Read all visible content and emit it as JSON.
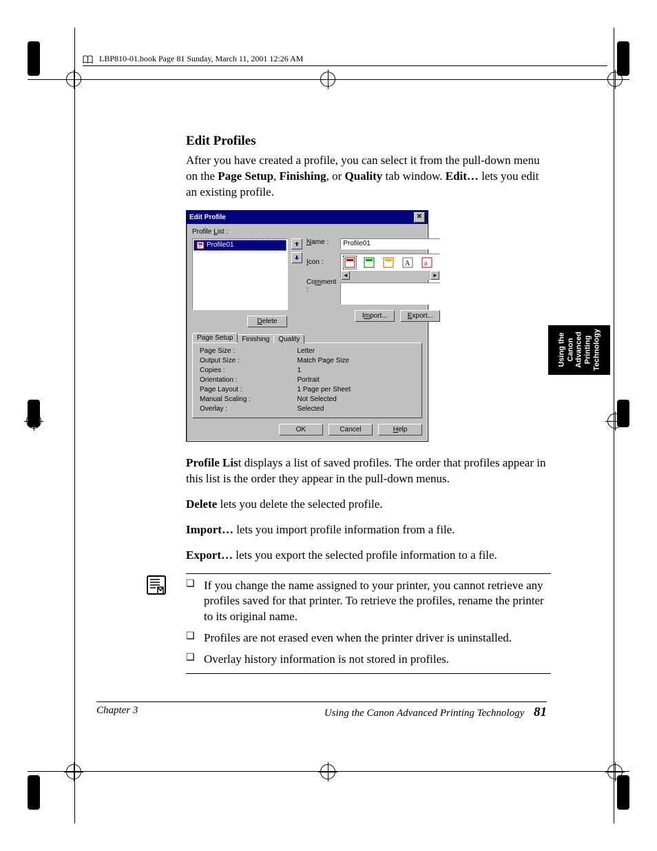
{
  "header": "LBP810-01.book  Page 81  Sunday, March 11, 2001  12:26 AM",
  "section_title": "Edit Profiles",
  "intro_html": "After you have created a profile, you can select it from the pull-down menu on the <b>Page Setup</b>, <b>Finishing</b>, or <b>Quality</b> tab window. <b>Edit…</b> lets you edit an existing profile.",
  "descriptions": {
    "profile_list": "<b>Profile Lis</b>t displays a list of saved profiles. The order that profiles appear in this list is the order they appear in the pull-down menus.",
    "delete": "<b>Delete</b> lets you delete the selected profile.",
    "import": "<b>Import…</b> lets you import profile information from a file.",
    "export": "<b>Export…</b> lets you export the selected profile information to a file."
  },
  "notes": [
    "If you change the name assigned to your printer, you cannot retrieve any profiles saved for that printer. To retrieve the profiles, rename the printer to its original name.",
    "Profiles are not erased even when the printer driver is uninstalled.",
    "Overlay history information is not stored in profiles."
  ],
  "footer": {
    "chapter": "Chapter 3",
    "title": "Using the Canon Advanced Printing Technology",
    "page": "81"
  },
  "side_tab": "Using the Canon Advanced Printing Technology",
  "dialog": {
    "title": "Edit Profile",
    "labels": {
      "profile_list": "Profile List :",
      "name": "Name :",
      "icon": "Icon :",
      "comment": "Comment :"
    },
    "selected_profile": "Profile01",
    "name_value": "Profile01",
    "buttons": {
      "delete": "Delete",
      "import": "Import...",
      "export": "Export...",
      "ok": "OK",
      "cancel": "Cancel",
      "help": "Help"
    },
    "tabs": [
      "Page Setup",
      "Finishing",
      "Quality"
    ],
    "active_tab": 0,
    "properties": [
      {
        "k": "Page Size :",
        "v": "Letter"
      },
      {
        "k": "Output Size :",
        "v": "Match Page Size"
      },
      {
        "k": "Copies :",
        "v": "1"
      },
      {
        "k": "Orientation :",
        "v": "Portrait"
      },
      {
        "k": "Page Layout :",
        "v": "1 Page per Sheet"
      },
      {
        "k": "Manual Scaling :",
        "v": "Not Selected"
      },
      {
        "k": "Overlay :",
        "v": "Selected"
      }
    ]
  }
}
